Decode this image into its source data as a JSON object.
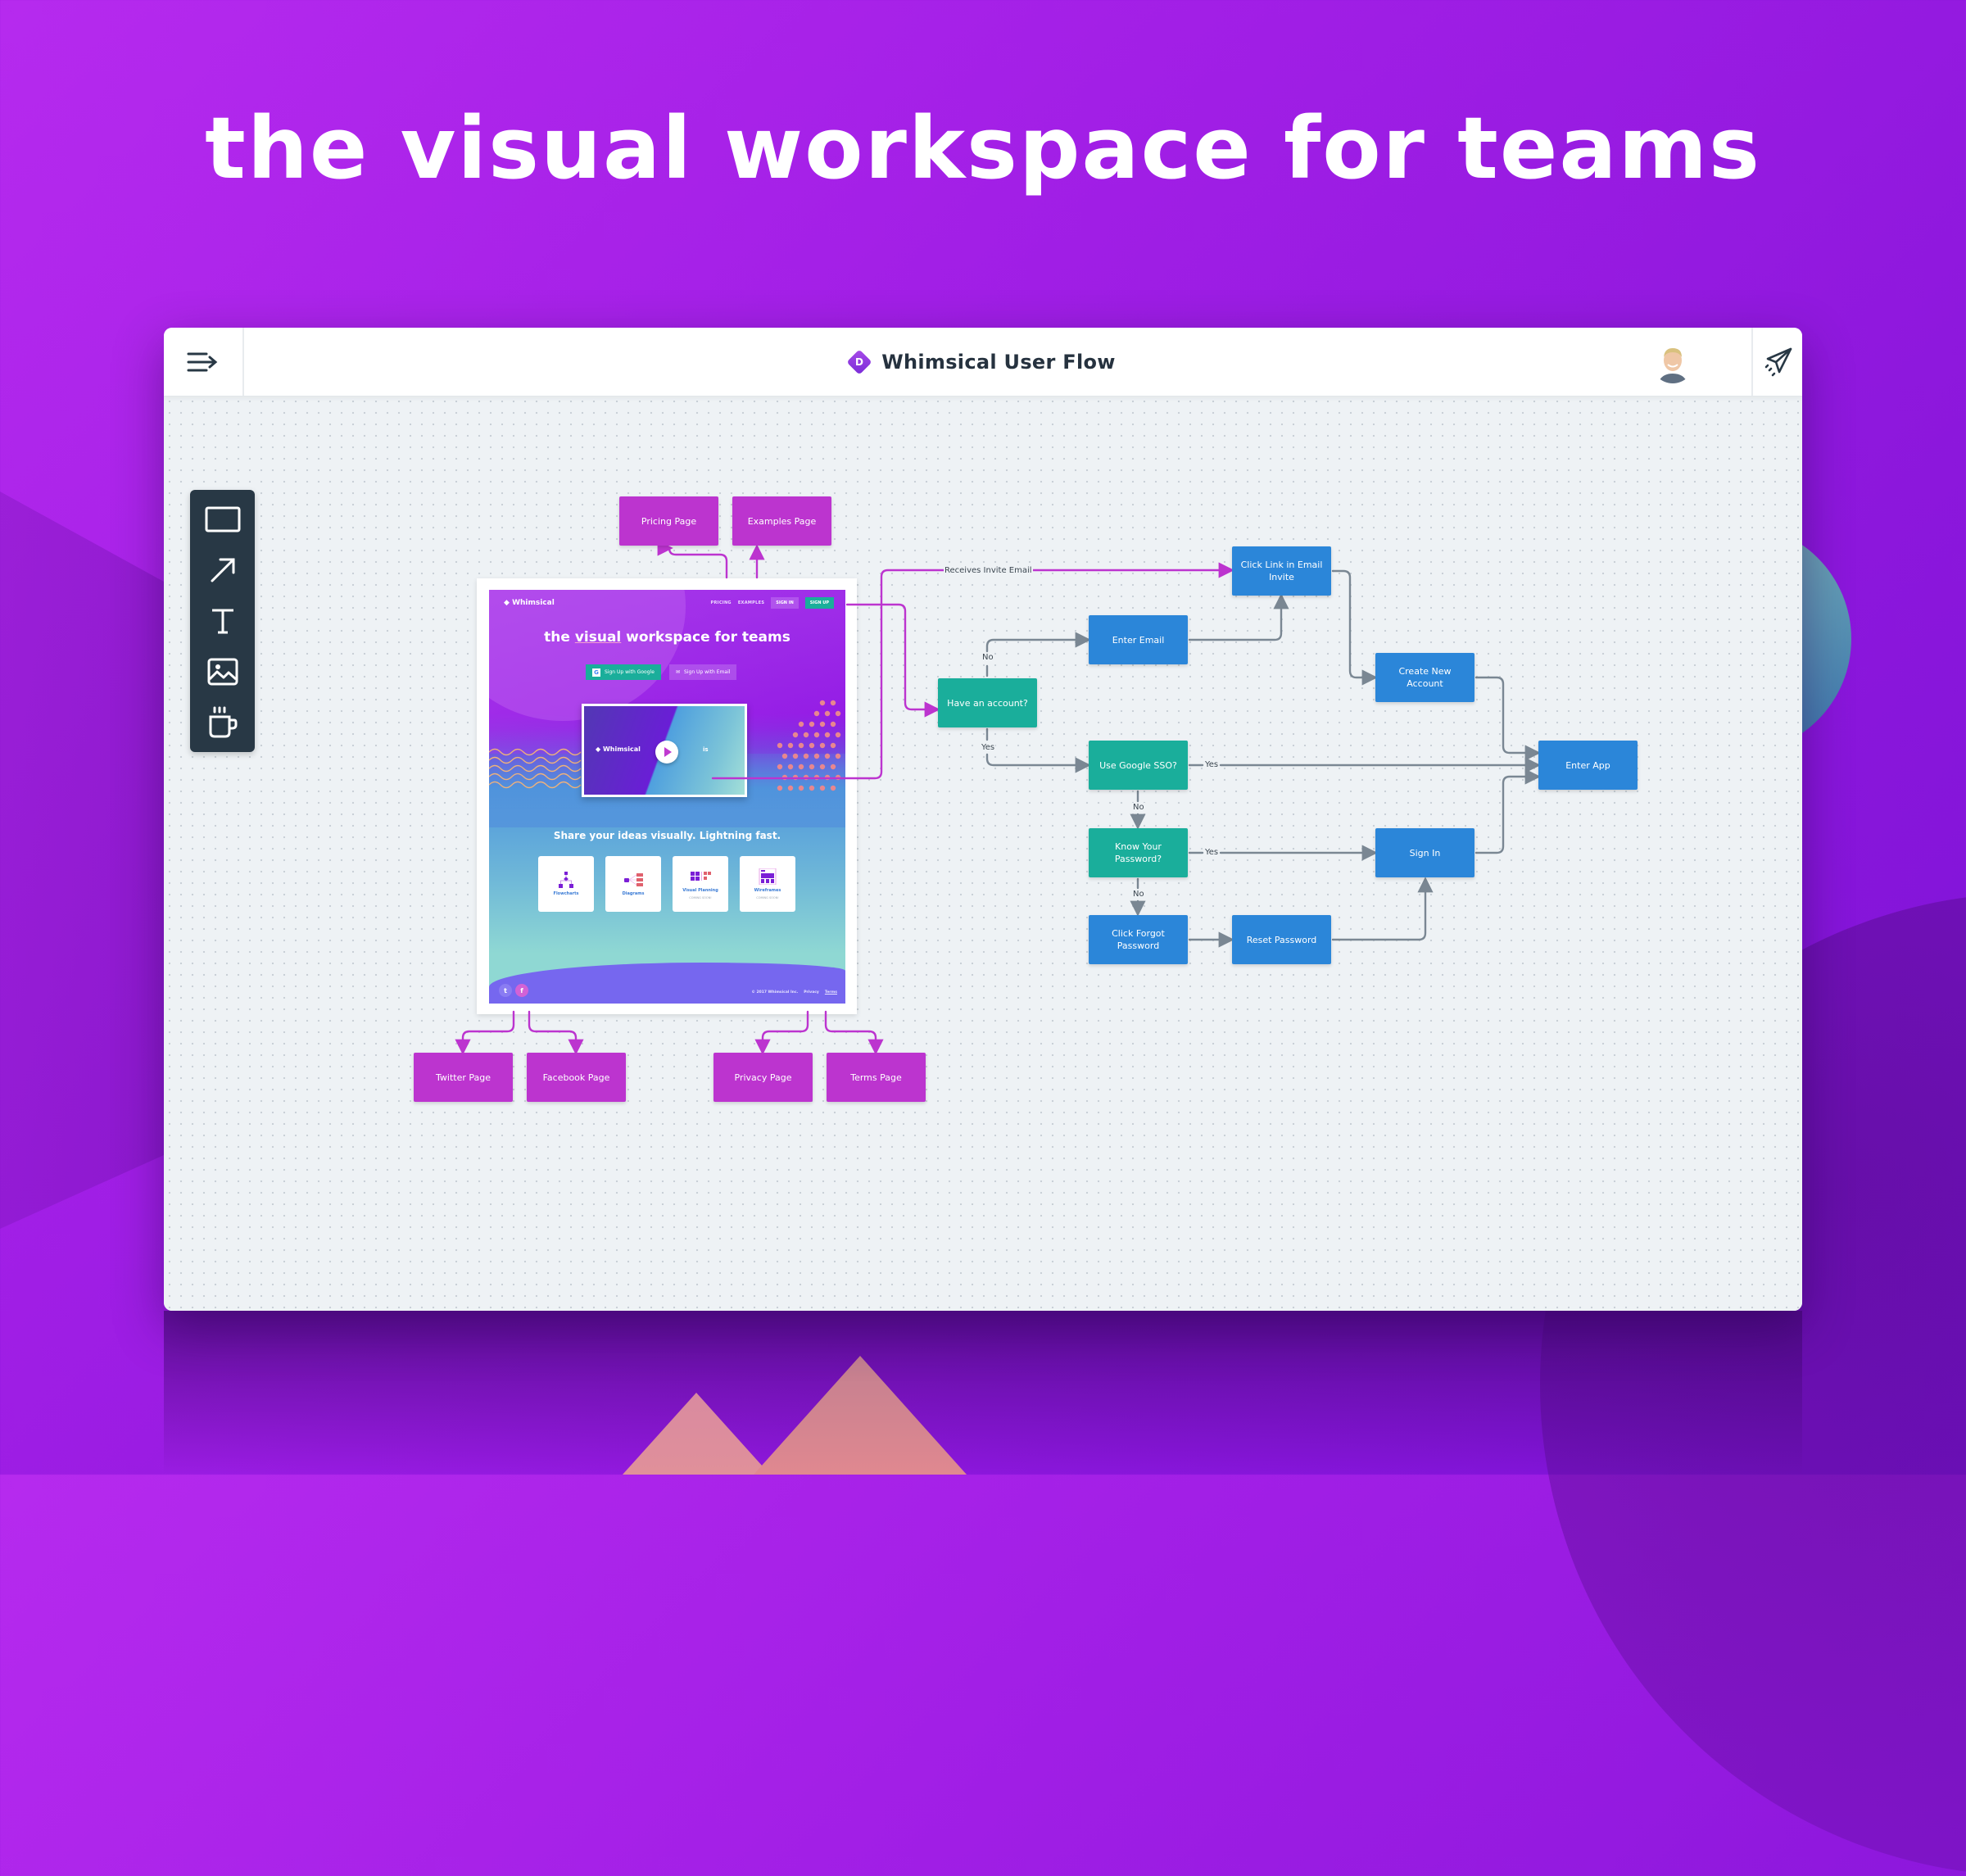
{
  "marketing": {
    "headline": "the visual workspace for teams"
  },
  "app": {
    "doc_badge_letter": "D",
    "doc_title": "Whimsical User Flow",
    "icons": {
      "menu": "menu-collapse-arrow-icon",
      "avatar": "user-avatar",
      "share": "paper-plane-icon"
    },
    "toolbar": [
      {
        "name": "rectangle-tool",
        "icon": "rectangle-icon"
      },
      {
        "name": "arrow-tool",
        "icon": "arrow-icon"
      },
      {
        "name": "text-tool",
        "icon": "text-icon"
      },
      {
        "name": "image-tool",
        "icon": "image-icon"
      },
      {
        "name": "coffee-tool",
        "icon": "coffee-cup-icon"
      }
    ]
  },
  "website_mockup": {
    "logo": "Whimsical",
    "nav": {
      "pricing": "PRICING",
      "examples": "EXAMPLES",
      "sign_in": "SIGN IN",
      "sign_up": "SIGN UP"
    },
    "hero_prefix": "the ",
    "hero_emph": "visual",
    "hero_suffix": " workspace for teams",
    "cta_google": "Sign Up with Google",
    "cta_email": "Sign Up with Email",
    "video_logo": "Whimsical",
    "video_text": "is",
    "subheadline": "Share your ideas visually. Lightning fast.",
    "cards": [
      {
        "label": "Flowcharts",
        "note": ""
      },
      {
        "label": "Diagrams",
        "note": ""
      },
      {
        "label": "Visual Planning",
        "note": "COMING SOON!"
      },
      {
        "label": "Wireframes",
        "note": "COMING SOON!"
      }
    ],
    "social": {
      "twitter": "t",
      "facebook": "f"
    },
    "copyright": "© 2017 Whimsical Inc.",
    "privacy": "Privacy",
    "terms": "Terms"
  },
  "flow": {
    "colors": {
      "page": "#bc34cf",
      "action": "#2b86d9",
      "decision": "#1aae9b",
      "connector": "#7a8793",
      "link_connector": "#bc34cf"
    },
    "nodes": {
      "pricing_page": "Pricing Page",
      "examples_page": "Examples Page",
      "click_link_email_invite": "Click Link in Email Invite",
      "enter_email": "Enter Email",
      "have_account": "Have an account?",
      "create_new_account": "Create New Account",
      "use_google_sso": "Use Google SSO?",
      "enter_app": "Enter App",
      "know_password": "Know Your Password?",
      "sign_in": "Sign In",
      "click_forgot_password": "Click Forgot Password",
      "reset_password": "Reset Password",
      "twitter_page": "Twitter Page",
      "facebook_page": "Facebook Page",
      "privacy_page": "Privacy Page",
      "terms_page": "Terms Page"
    },
    "edge_labels": {
      "receives_invite": "Receives Invite Email",
      "no_account": "No",
      "yes_account": "Yes",
      "sso_yes": "Yes",
      "sso_no": "No",
      "pw_yes": "Yes",
      "pw_no": "No"
    }
  }
}
